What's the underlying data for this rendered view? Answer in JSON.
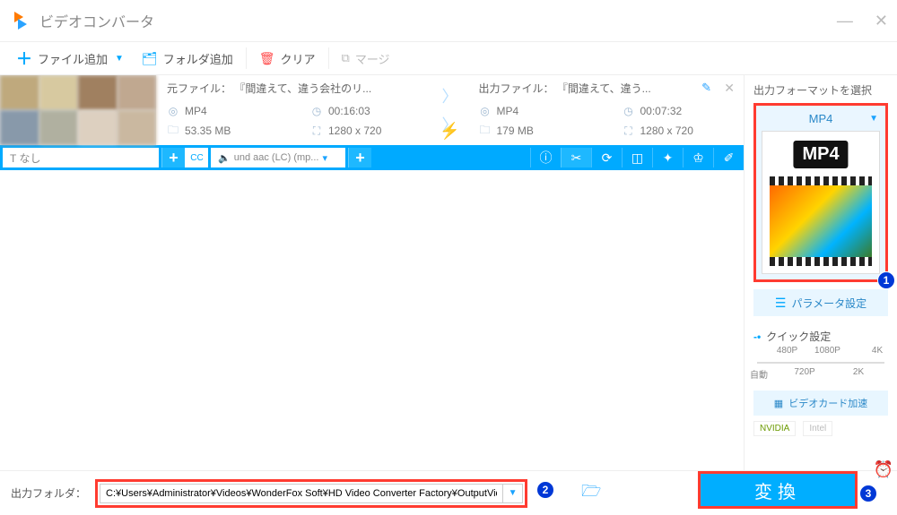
{
  "window": {
    "title": "ビデオコンバータ"
  },
  "toolbar": {
    "add_file": "ファイル追加",
    "add_folder": "フォルダ追加",
    "clear": "クリア",
    "merge": "マージ"
  },
  "item": {
    "source": {
      "label": "元ファイル：",
      "name": "『間違えて、違う会社のリ...",
      "format": "MP4",
      "duration": "00:16:03",
      "size": "53.35 MB",
      "resolution": "1280 x 720"
    },
    "output": {
      "label": "出力ファイル：",
      "name": "『間違えて、違う...",
      "format": "MP4",
      "duration": "00:07:32",
      "size": "179 MB",
      "resolution": "1280 x 720"
    },
    "subtitle": "T なし",
    "cc": "CC",
    "audio": "und aac (LC) (mp..."
  },
  "side": {
    "title": "出力フォーマットを選択",
    "format": "MP4",
    "format_badge": "MP4",
    "param": "パラメータ設定",
    "quick": "クイック設定",
    "presets_top": [
      "480P",
      "1080P",
      "4K"
    ],
    "presets_bottom": [
      "自動",
      "720P",
      "2K"
    ],
    "gpu": "ビデオカード加速",
    "vendors": {
      "nvidia": "NVIDIA",
      "intel": "Intel"
    }
  },
  "footer": {
    "label": "出力フォルダ：",
    "path": "C:¥Users¥Administrator¥Videos¥WonderFox Soft¥HD Video Converter Factory¥OutputVideo¥",
    "convert": "変換"
  },
  "badges": {
    "n1": "1",
    "n2": "2",
    "n3": "3"
  }
}
